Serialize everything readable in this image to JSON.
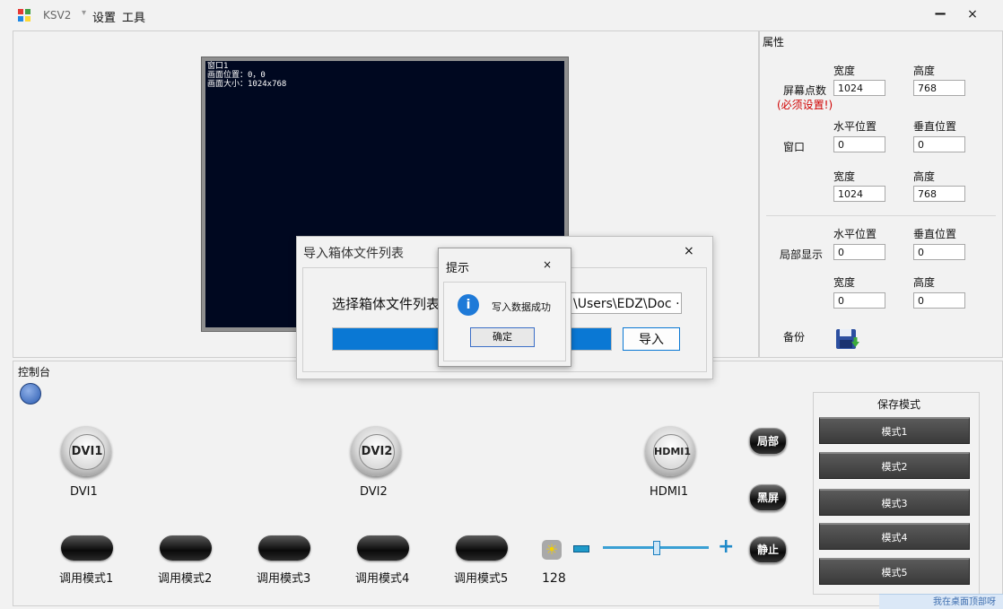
{
  "titlebar": {
    "app_name": "KSV2",
    "app_caret": "▾",
    "menu": [
      "设置",
      "工具"
    ],
    "minimize": "−",
    "close": "×",
    "logo_colors": [
      "#e53935",
      "#43a047",
      "#1e88e5",
      "#fdd835"
    ]
  },
  "preview": {
    "lines": [
      "窗口1",
      "画面位置：0，0",
      "画面大小：1024x768"
    ]
  },
  "properties": {
    "title": "属性",
    "screen_points": {
      "label": "屏幕点数",
      "note": "(必须设置!)",
      "width_label": "宽度",
      "height_label": "高度",
      "width": "1024",
      "height": "768"
    },
    "window": {
      "label": "窗口",
      "h_label": "水平位置",
      "v_label": "垂直位置",
      "h": "0",
      "v": "0",
      "width_label": "宽度",
      "height_label": "高度",
      "width": "1024",
      "height": "768"
    },
    "local_display": {
      "label": "局部显示",
      "h_label": "水平位置",
      "v_label": "垂直位置",
      "h": "0",
      "v": "0",
      "width_label": "宽度",
      "height_label": "高度",
      "width": "0",
      "height": "0"
    },
    "backup": {
      "label": "备份"
    }
  },
  "console": {
    "title": "控制台",
    "sources": [
      {
        "icon": "DVI1",
        "label": "DVI1"
      },
      {
        "icon": "DVI2",
        "label": "DVI2"
      },
      {
        "icon": "HDMI1",
        "label": "HDMI1"
      }
    ],
    "call_modes": [
      "调用模式1",
      "调用模式2",
      "调用模式3",
      "调用模式4",
      "调用模式5"
    ],
    "round_buttons": [
      "局部",
      "黑屏",
      "静止"
    ],
    "brightness": "128",
    "brightness_fraction": 0.5,
    "save_mode_title": "保存模式",
    "save_modes": [
      "模式1",
      "模式2",
      "模式3",
      "模式4",
      "模式5"
    ]
  },
  "import_dialog": {
    "title": "导入箱体文件列表",
    "close": "×",
    "label": "选择箱体文件列表",
    "path": "\\Users\\EDZ\\Doc ···",
    "import_button": "导入",
    "progress_fraction": 1.0
  },
  "message_box": {
    "title": "提示",
    "close": "×",
    "text": "写入数据成功",
    "ok": "确定"
  },
  "tray": {
    "text": "我在桌面顶部呀"
  }
}
